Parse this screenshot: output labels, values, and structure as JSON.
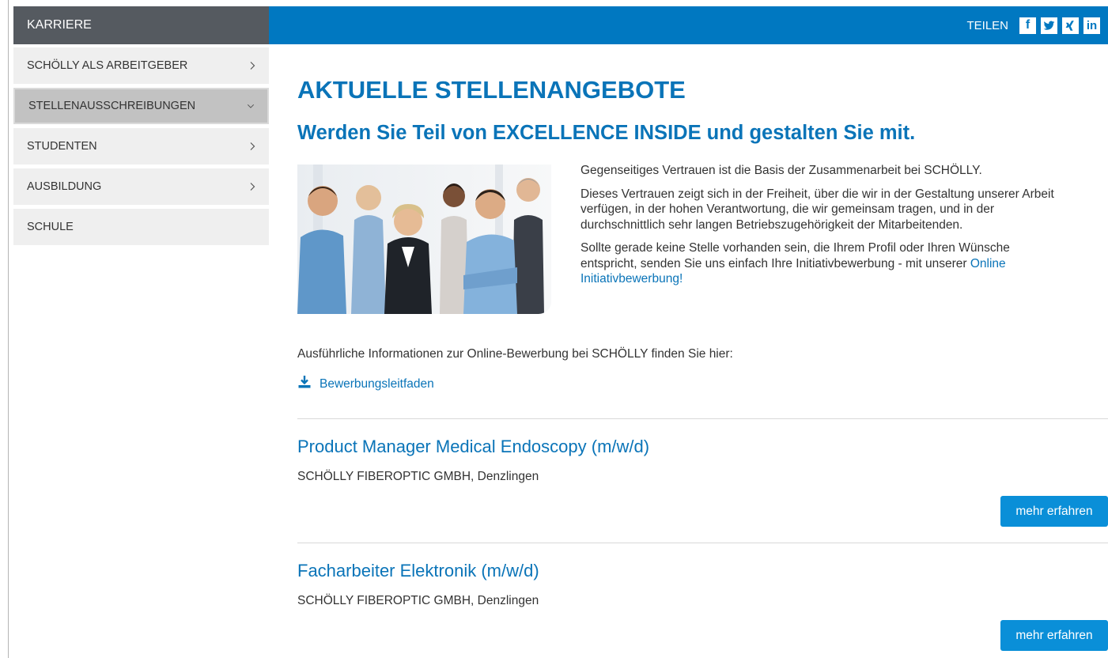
{
  "sidebar": {
    "header": "KARRIERE",
    "items": [
      {
        "label": "SCHÖLLY ALS ARBEITGEBER",
        "chevron": "chevron-right-icon",
        "active": false
      },
      {
        "label": "STELLENAUSSCHREIBUNGEN",
        "chevron": "chevron-down-icon",
        "active": true
      },
      {
        "label": "STUDENTEN",
        "chevron": "chevron-right-icon",
        "active": false
      },
      {
        "label": "AUSBILDUNG",
        "chevron": "chevron-right-icon",
        "active": false
      },
      {
        "label": "SCHULE",
        "chevron": "",
        "active": false
      }
    ]
  },
  "share": {
    "label": "TEILEN",
    "icons": [
      "facebook-icon",
      "twitter-icon",
      "xing-icon",
      "linkedin-icon"
    ]
  },
  "main": {
    "title": "AKTUELLE STELLENANGEBOTE",
    "subtitle": "Werden Sie Teil von EXCELLENCE INSIDE und gestalten Sie mit.",
    "intro": {
      "p1": "Gegenseitiges Vertrauen ist die Basis der Zusammenarbeit bei SCHÖLLY.",
      "p2": "Dieses Vertrauen zeigt sich in der Freiheit, über die wir in der Gestaltung unserer Arbeit verfügen, in der hohen Verantwortung, die wir gemeinsam tragen, und in der durchschnittlich sehr langen Betriebszugehörigkeit der Mitarbeitenden.",
      "p3_line1": "Sollte gerade keine Stelle vorhanden sein, die Ihrem Profil oder Ihren Wünsche",
      "p3_line2": "entspricht, senden Sie uns einfach Ihre Initiativbewerbung - mit unserer ",
      "p3_link_part1": "Online",
      "p3_link_part2": "Initiativbewerbung!"
    },
    "info_text": "Ausführliche Informationen zur Online-Bewerbung bei SCHÖLLY finden Sie hier:",
    "download_label": "Bewerbungsleitfaden"
  },
  "jobs": [
    {
      "title": "Product Manager Medical Endoscopy (m/w/d)",
      "company": "SCHÖLLY FIBEROPTIC GMBH, Denzlingen",
      "button": "mehr erfahren"
    },
    {
      "title": "Facharbeiter Elektronik (m/w/d)",
      "company": "SCHÖLLY FIBEROPTIC GMBH, Denzlingen",
      "button": "mehr erfahren"
    }
  ],
  "colors": {
    "brand_blue": "#0078c1",
    "link_blue": "#0a74b8",
    "button_blue": "#0a8fd8",
    "sidebar_header": "#555a60"
  }
}
